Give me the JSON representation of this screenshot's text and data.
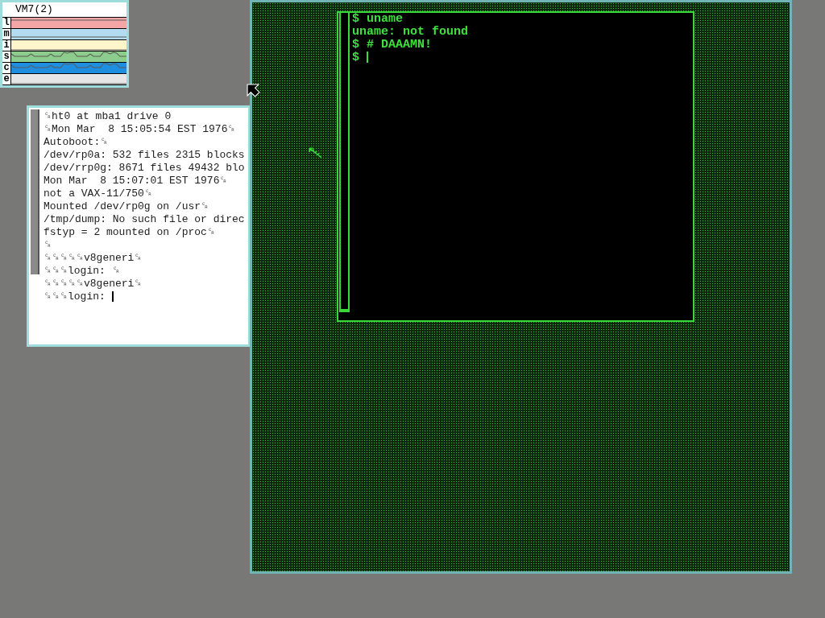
{
  "vm_monitor": {
    "title": "VM7(2)",
    "meters": [
      {
        "label": "l",
        "color": "#f4a6a6"
      },
      {
        "label": "m",
        "color": "#b4dcf0"
      },
      {
        "label": "i",
        "color": "#fff6cc"
      },
      {
        "label": "s",
        "color": "#8ccc8c"
      },
      {
        "label": "c",
        "color": "#1e8ee0"
      },
      {
        "label": "e",
        "color": "#e6e6e6"
      }
    ]
  },
  "console_window": {
    "lines": [
      "␍ht0 at mba1 drive 0",
      "␍Mon Mar  8 15:05:54 EST 1976␍",
      "Autoboot:␍",
      "/dev/rp0a: 532 files 2315 blocks",
      "/dev/rrp0g: 8671 files 49432 blo",
      "Mon Mar  8 15:07:01 EST 1976␍",
      "not a VAX-11/750␍",
      "Mounted /dev/rp0g on /usr␍",
      "/tmp/dump: No such file or direc",
      "fstyp = 2 mounted on /proc␍",
      "␍",
      "␍␍␍␍␍v8generi␍",
      "␍␍␍login: ␍",
      "␍␍␍␍␍v8generi␍",
      "␍␍␍login: "
    ]
  },
  "shell_window": {
    "lines": [
      "$ uname",
      "uname: not found",
      "$ # DAAAMN!",
      "$ "
    ]
  }
}
